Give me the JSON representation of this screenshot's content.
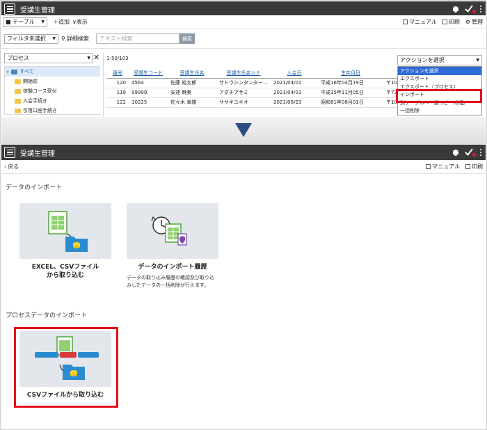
{
  "app": {
    "title": "受講生管理"
  },
  "top": {
    "toolbar": {
      "view_select": "■ テーブル",
      "add": "＋追加",
      "display": "∨表示",
      "manual": "マニュアル",
      "print": "印刷",
      "manage": "管理"
    },
    "filter_select": "フィルタ未選択",
    "detail_search": "詳細検索",
    "search_placeholder": "テキスト検索",
    "search_button": "検索",
    "process_select": "プロセス",
    "tree": [
      "すべて",
      "開始前",
      "体験コース受付",
      "入会手続き",
      "引落口座手続き"
    ],
    "count": "1-50/103",
    "action_select": "アクションを選択",
    "columns": [
      "番号",
      "受講生コード",
      "受講生氏名",
      "受講生氏名カナ",
      "入会日",
      "生年月日"
    ],
    "rows": [
      [
        "120",
        "4564",
        "佐藤 裕太郎",
        "サトウシンタンター…",
        "2021/04/01",
        "平成16年04月19日",
        "〒10"
      ],
      [
        "119",
        "99999",
        "安達 麻美",
        "アダチアサミ",
        "2021/04/01",
        "平成15年11月05日",
        "〒73"
      ],
      [
        "122",
        "10225",
        "佐々木 幸雄",
        "ササキユキオ",
        "2021/08/23",
        "昭和61年08月01日",
        "〒10"
      ]
    ],
    "dropdown": [
      "アクションを選択",
      "エクスポート",
      "エクスポート（プロセス）",
      "インポート",
      "別テーブルへ一括コピー/移動",
      "一括削除"
    ]
  },
  "bottom": {
    "back": "戻る",
    "manual": "マニュアル",
    "print": "印刷",
    "section1": "データのインポート",
    "section2": "プロセスデータのインポート",
    "card1": "EXCEL、CSVファイル\nから取り込む",
    "card2": "データのインポート履歴",
    "card2_desc": "データの取り込み履歴の確認及び取り込みしたデータの一括削除が行えます。",
    "card3": "CSVファイルから取り込む"
  },
  "colors": {
    "header": "#3a3a3a",
    "highlight_red": "#e0101a",
    "arrow": "#2b4f82"
  },
  "icons": [
    "menu-icon",
    "bell-icon",
    "check-icon",
    "kebab-icon",
    "folder-icon",
    "spreadsheet-icon",
    "history-icon"
  ]
}
